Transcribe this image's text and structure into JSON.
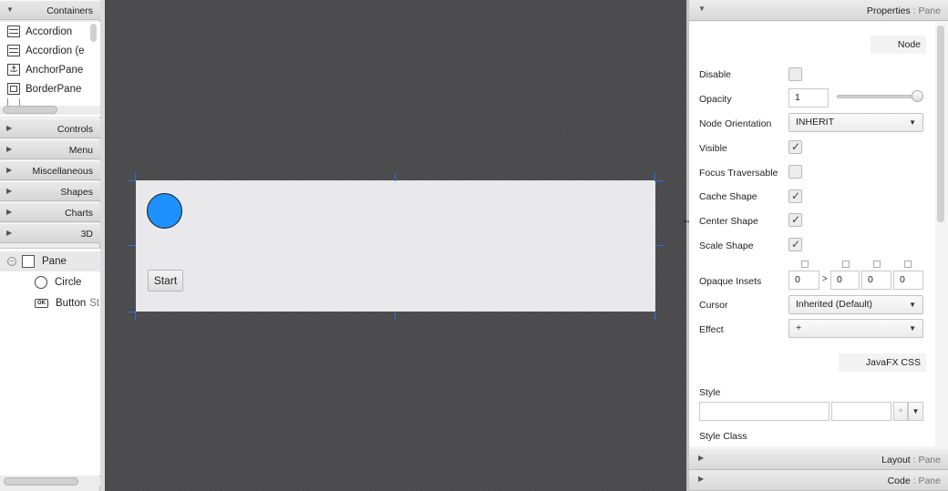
{
  "library": {
    "sections": [
      {
        "label": "Containers",
        "expanded": true
      },
      {
        "label": "Controls",
        "expanded": false
      },
      {
        "label": "Menu",
        "expanded": false
      },
      {
        "label": "Miscellaneous",
        "expanded": false
      },
      {
        "label": "Shapes",
        "expanded": false
      },
      {
        "label": "Charts",
        "expanded": false
      },
      {
        "label": "3D",
        "expanded": false
      }
    ],
    "container_items": [
      {
        "label": "Accordion",
        "icon": "accordion-icon"
      },
      {
        "label": "Accordion  (e",
        "icon": "accordion-icon"
      },
      {
        "label": "AnchorPane",
        "icon": "anchor-pane-icon"
      },
      {
        "label": "BorderPane",
        "icon": "border-pane-icon"
      }
    ]
  },
  "hierarchy": {
    "root": {
      "label": "Pane",
      "icon": "pane-icon"
    },
    "children": [
      {
        "label": "Circle",
        "icon": "circle-icon"
      },
      {
        "label": "Button",
        "suffix": "St",
        "icon": "button-icon"
      }
    ]
  },
  "canvas": {
    "button_label": "Start",
    "circle_color": "#1e90ff",
    "background": "#4a4a4d"
  },
  "properties": {
    "header_title": "Properties",
    "header_target": "Pane",
    "node_section": "Node",
    "disable": {
      "label": "Disable",
      "checked": false
    },
    "opacity": {
      "label": "Opacity",
      "value": "1"
    },
    "node_orientation": {
      "label": "Node Orientation",
      "value": "INHERIT"
    },
    "visible": {
      "label": "Visible",
      "checked": true
    },
    "focus_traversable": {
      "label": "Focus Traversable",
      "checked": false
    },
    "cache_shape": {
      "label": "Cache Shape",
      "checked": true
    },
    "center_shape": {
      "label": "Center Shape",
      "checked": true
    },
    "scale_shape": {
      "label": "Scale Shape",
      "checked": true
    },
    "opaque_insets": {
      "label": "Opaque Insets",
      "values": [
        "0",
        "0",
        "0",
        "0"
      ],
      "separator": ">"
    },
    "cursor": {
      "label": "Cursor",
      "value": "Inherited (Default)"
    },
    "effect": {
      "label": "Effect",
      "value": "+"
    },
    "css_section": "JavaFX CSS",
    "style": {
      "label": "Style",
      "add": "+"
    },
    "style_class": {
      "label": "Style Class"
    }
  },
  "layout_panel": {
    "title": "Layout",
    "target": "Pane"
  },
  "code_panel": {
    "title": "Code",
    "target": "Pane"
  }
}
